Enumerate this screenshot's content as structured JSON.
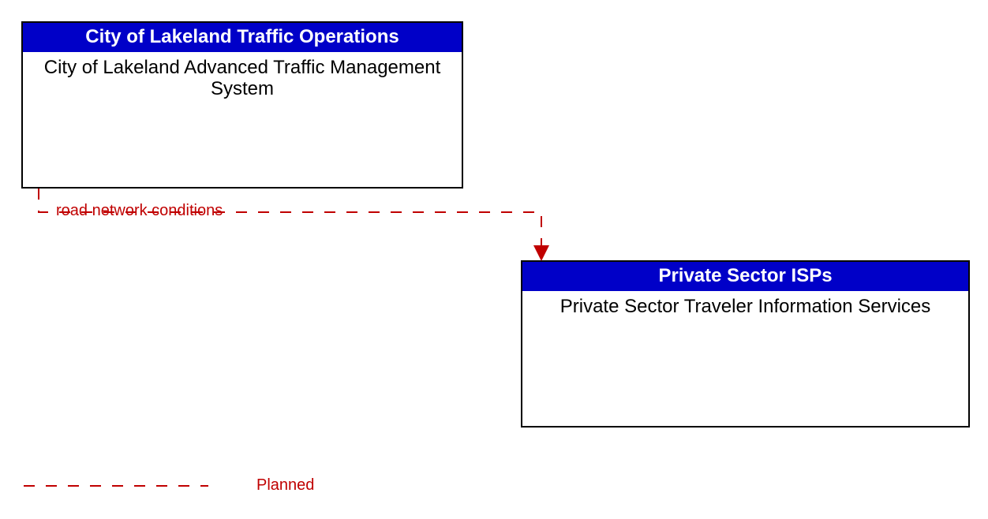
{
  "boxes": {
    "source": {
      "header": "City of Lakeland Traffic Operations",
      "body": "City of Lakeland Advanced Traffic Management System"
    },
    "target": {
      "header": "Private Sector ISPs",
      "body": "Private Sector Traveler Information Services"
    }
  },
  "flow_label": "road network conditions",
  "legend": {
    "planned": "Planned"
  },
  "colors": {
    "header_bg": "#0000c8",
    "planned_line": "#c00000",
    "box_border": "#000000"
  }
}
